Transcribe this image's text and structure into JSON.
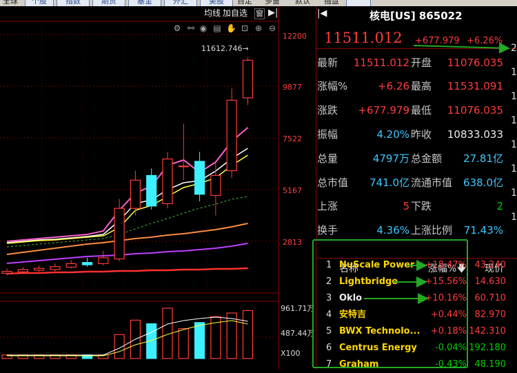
{
  "top_tabs": [
    "全球",
    "个股",
    "指数",
    "期货",
    "基金",
    "外汇",
    "美股",
    "自定",
    "多窗",
    "默认",
    "插盘"
  ],
  "toolbar": {
    "avg_label": "均线",
    "add_watch_label": "加自选",
    "window_label": "窗"
  },
  "chart": {
    "price_labels": [
      "12200",
      "9877",
      "7522",
      "5167",
      "2813"
    ],
    "high_annotation": "11612.746",
    "vol_labels": [
      "961.71万",
      "487.44万"
    ],
    "vol_unit": "X100"
  },
  "chart_data": {
    "type": "candlestick",
    "ylim": [
      1600,
      12800
    ],
    "candles": [
      {
        "o": 2440,
        "c": 2520,
        "h": 2650,
        "l": 2350
      },
      {
        "o": 2500,
        "c": 2600,
        "h": 2700,
        "l": 2420
      },
      {
        "o": 2570,
        "c": 2650,
        "h": 2760,
        "l": 2500
      },
      {
        "o": 2600,
        "c": 2720,
        "h": 2860,
        "l": 2530
      },
      {
        "o": 2700,
        "c": 2850,
        "h": 3000,
        "l": 2640
      },
      {
        "o": 2900,
        "c": 2800,
        "h": 3100,
        "l": 2720
      },
      {
        "o": 2850,
        "c": 3100,
        "h": 3400,
        "l": 2780
      },
      {
        "o": 3050,
        "c": 5200,
        "h": 5600,
        "l": 2950
      },
      {
        "o": 5200,
        "c": 6400,
        "h": 6800,
        "l": 4900
      },
      {
        "o": 6600,
        "c": 5300,
        "h": 6900,
        "l": 5150
      },
      {
        "o": 5400,
        "c": 7300,
        "h": 7600,
        "l": 5200
      },
      {
        "o": 7000,
        "c": 7000,
        "h": 8800,
        "l": 6400
      },
      {
        "o": 7200,
        "c": 5800,
        "h": 7600,
        "l": 5500
      },
      {
        "o": 5750,
        "c": 6600,
        "h": 7200,
        "l": 4900
      },
      {
        "o": 6800,
        "c": 9800,
        "h": 10300,
        "l": 6500
      },
      {
        "o": 9900,
        "c": 11500,
        "h": 11612,
        "l": 9600
      }
    ],
    "volumes": [
      30,
      30,
      30,
      30,
      30,
      30,
      30,
      200,
      320,
      290,
      420,
      250,
      300,
      350,
      380,
      400
    ],
    "vol_max": 961.71,
    "vol_unit": "万"
  },
  "panel": {
    "title": "核电[US] 865022",
    "price": "11511.012",
    "change": "+677.979",
    "change_pct": "+6.26%",
    "rows": [
      {
        "l1": "最新",
        "v1": "11511.012",
        "l2": "开盘",
        "v2": "11076.035",
        "c1": "red",
        "c2": "red"
      },
      {
        "l1": "涨幅%",
        "v1": "+6.26",
        "l2": "最高",
        "v2": "11531.091",
        "c1": "red",
        "c2": "red"
      },
      {
        "l1": "涨跌",
        "v1": "+677.979",
        "l2": "最低",
        "v2": "11076.035",
        "c1": "red",
        "c2": "red"
      },
      {
        "l1": "振幅",
        "v1": "4.20%",
        "l2": "昨收",
        "v2": "10833.033",
        "c1": "cyan",
        "c2": "white"
      },
      {
        "l1": "总量",
        "v1": "4797万",
        "l2": "总金额",
        "v2": "27.81亿",
        "c1": "cyan",
        "c2": "cyan"
      },
      {
        "l1": "总市值",
        "v1": "741.0亿",
        "l2": "流通市值",
        "v2": "638.0亿",
        "c1": "cyan",
        "c2": "cyan"
      },
      {
        "l1": "上涨",
        "v1": "5",
        "l2": "下跌",
        "v2": "2",
        "c1": "red",
        "c2": "green"
      },
      {
        "l1": "换手",
        "v1": "4.36%",
        "l2": "上涨比例",
        "v2": "71.43%",
        "c1": "cyan",
        "c2": "cyan"
      }
    ],
    "edge_labels": [
      "2",
      "1",
      "1",
      "1",
      "1",
      "1",
      "1",
      "1"
    ]
  },
  "stock_list": {
    "headers": {
      "name": "名称",
      "pct": "涨幅%",
      "price": "现价"
    },
    "rows": [
      {
        "n": "1",
        "name": "NuScale Power",
        "pct": "+18.47%",
        "price": "43.240",
        "nc": "yellow",
        "pc": "red",
        "rc": "red"
      },
      {
        "n": "2",
        "name": "Lightbridge",
        "pct": "+15.56%",
        "price": "14.630",
        "nc": "yellow",
        "pc": "red",
        "rc": "red"
      },
      {
        "n": "3",
        "name": "Oklo",
        "pct": "+10.16%",
        "price": "60.710",
        "nc": "white",
        "pc": "red",
        "rc": "red"
      },
      {
        "n": "4",
        "name": "安特吉",
        "pct": "+0.44%",
        "price": "82.970",
        "nc": "yellow",
        "pc": "red",
        "rc": "red"
      },
      {
        "n": "5",
        "name": "BWX Technolo...",
        "pct": "+0.18%",
        "price": "142.310",
        "nc": "yellow",
        "pc": "red",
        "rc": "red"
      },
      {
        "n": "6",
        "name": "Centrus Energy",
        "pct": "-0.04%",
        "price": "192.180",
        "nc": "yellow",
        "pc": "green",
        "rc": "green"
      },
      {
        "n": "7",
        "name": "Graham",
        "pct": "-0.43%",
        "price": "48.190",
        "nc": "yellow",
        "pc": "green",
        "rc": "green"
      }
    ]
  },
  "colors": {
    "up": "#ff3c3c",
    "down": "#3cf0ff",
    "grid": "#8b0000",
    "highlight": "#22aa22"
  }
}
